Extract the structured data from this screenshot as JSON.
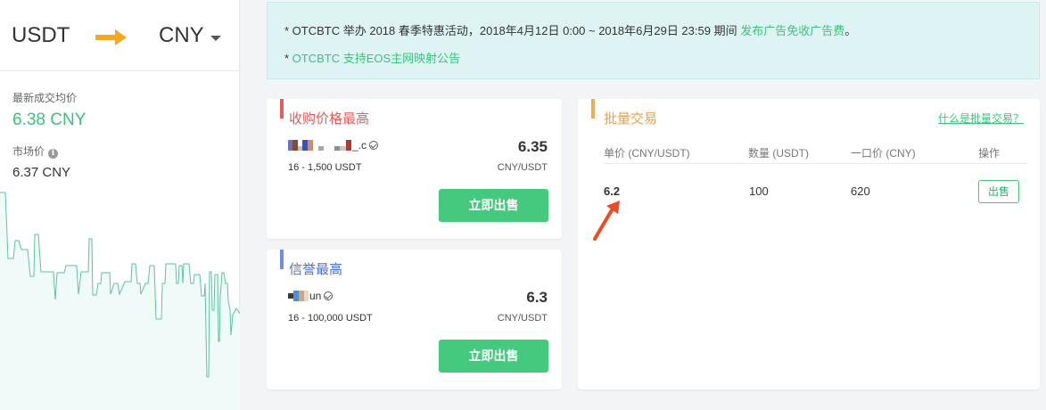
{
  "pair": {
    "from": "USDT",
    "to": "CNY"
  },
  "stats": {
    "last_label": "最新成交均价",
    "last_value": "6.38 CNY",
    "market_label": "市场价",
    "market_value": "6.37 CNY"
  },
  "notice": {
    "line1_text": "* OTCBTC 举办 2018 春季特惠活动，2018年4月12日 0:00 ~ 2018年6月29日 23:59 期间 ",
    "line1_link": "发布广告免收广告费",
    "line1_end": "。",
    "line2_star": "* ",
    "line2_link": "OTCBTC 支持EOS主网映射公告"
  },
  "sell_card": {
    "title": "收购价格最高",
    "merchant_suffix": "_.c",
    "range": "16 - 1,500 USDT",
    "price": "6.35",
    "unit": "CNY/USDT",
    "button": "立即出售"
  },
  "trust_card": {
    "title": "信誉最高",
    "merchant_suffix": "un",
    "range": "16 - 100,000 USDT",
    "price": "6.3",
    "unit": "CNY/USDT",
    "button": "立即出售"
  },
  "batch": {
    "title": "批量交易",
    "help_link": "什么是批量交易？",
    "headers": [
      "单价 (CNY/USDT)",
      "数量 (USDT)",
      "一口价 (CNY)",
      "操作"
    ],
    "row": {
      "price": "6.2",
      "quantity": "100",
      "total": "620",
      "action": "出售"
    }
  },
  "colors": {
    "accent_green": "#3cc27a",
    "sell_bar": "#e55b5b",
    "trust_bar": "#6f8fe0",
    "batch_bar": "#f0ad4e",
    "annotation": "#f04a24"
  },
  "icons": [
    "arrow-right-icon",
    "caret-down-icon",
    "info-icon",
    "verified-icon",
    "annotation-arrow-icon"
  ]
}
